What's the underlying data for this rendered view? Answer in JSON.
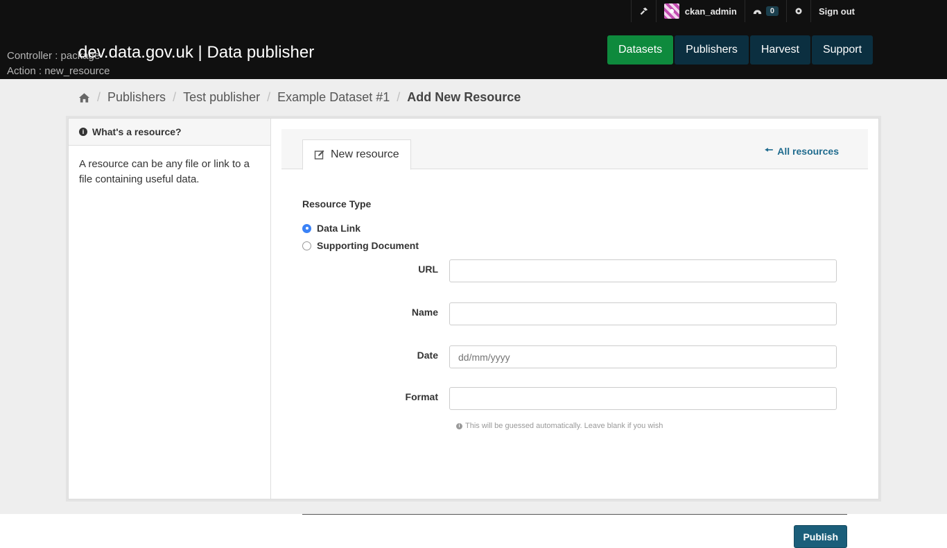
{
  "header": {
    "site_title": "dev.data.gov.uk | Data publisher",
    "debug_controller": "Controller : package",
    "debug_action": "Action : new_resource",
    "username": "ckan_admin",
    "dashboard_count": "0",
    "sign_out": "Sign out",
    "nav": [
      {
        "label": "Datasets",
        "active": true
      },
      {
        "label": "Publishers",
        "active": false
      },
      {
        "label": "Harvest",
        "active": false
      },
      {
        "label": "Support",
        "active": false
      }
    ]
  },
  "breadcrumb": {
    "items": [
      "Publishers",
      "Test publisher",
      "Example Dataset #1"
    ],
    "current": "Add New Resource"
  },
  "sidebar": {
    "heading": "What's a resource?",
    "text": "A resource can be any file or link to a file containing useful data."
  },
  "tabs": {
    "active": "New resource",
    "all_resources": "All resources"
  },
  "form": {
    "resource_type_label": "Resource Type",
    "options": [
      {
        "label": "Data Link",
        "checked": true
      },
      {
        "label": "Supporting Document",
        "checked": false
      }
    ],
    "url_label": "URL",
    "url_value": "",
    "name_label": "Name",
    "name_value": "",
    "date_label": "Date",
    "date_placeholder": "dd/mm/yyyy",
    "format_label": "Format",
    "format_value": "",
    "format_help": "This will be guessed automatically. Leave blank if you wish",
    "publish": "Publish"
  },
  "colors": {
    "nav_active": "#0e8a3d",
    "nav_default": "#0b2f40",
    "publish": "#1b5e7a",
    "link": "#1f6b8e",
    "radio_checked": "#3b82f6"
  }
}
